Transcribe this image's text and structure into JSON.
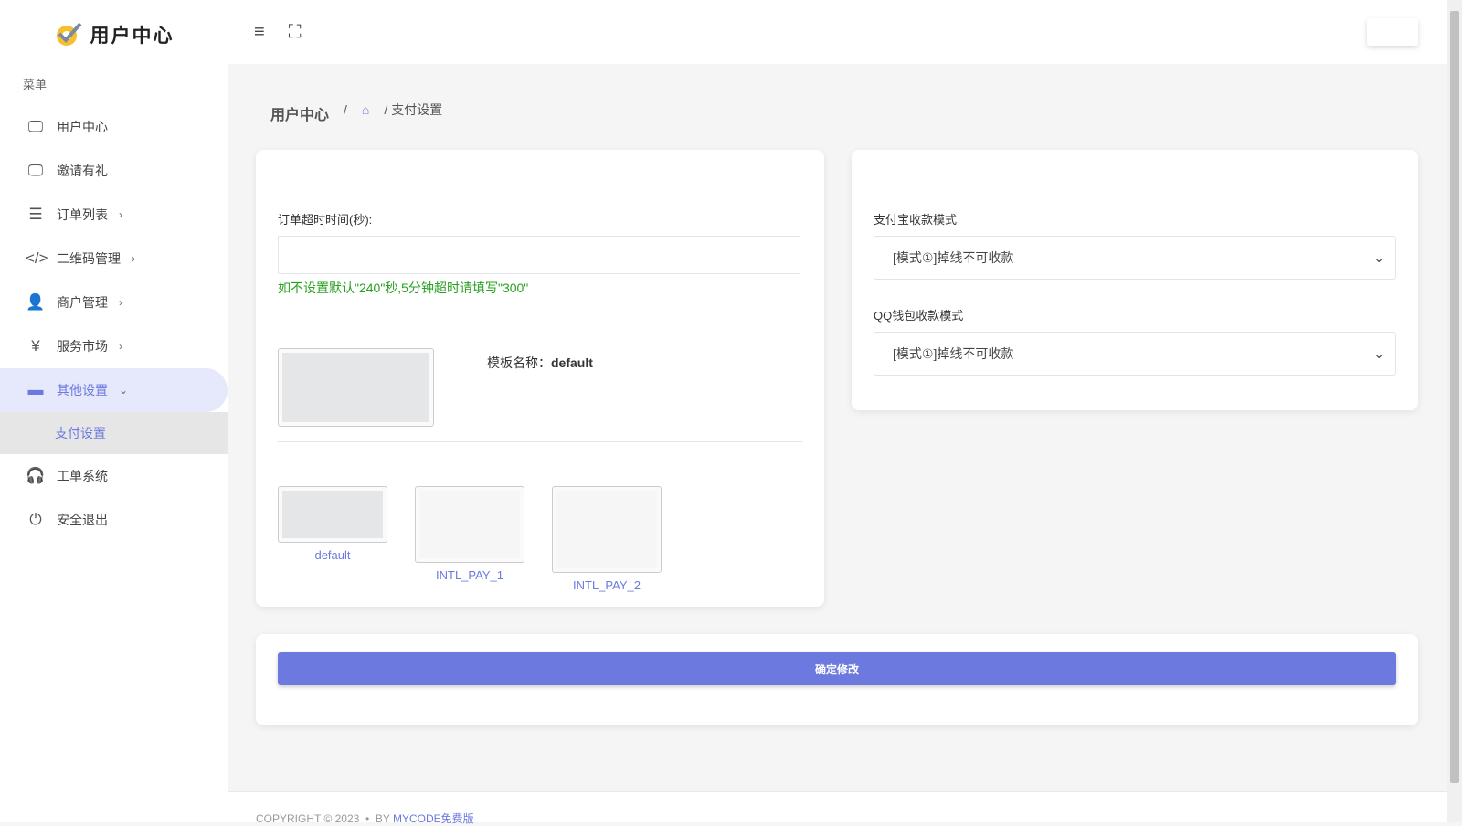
{
  "brand": {
    "title": "用户中心"
  },
  "sidebar": {
    "menu_title": "菜单",
    "items": [
      {
        "label": "用户中心",
        "icon": "monitor-icon"
      },
      {
        "label": "邀请有礼",
        "icon": "monitor-icon"
      },
      {
        "label": "订单列表",
        "icon": "list-icon"
      },
      {
        "label": "二维码管理",
        "icon": "code-icon"
      },
      {
        "label": "商户管理",
        "icon": "user-icon"
      },
      {
        "label": "服务市场",
        "icon": "yen-icon"
      },
      {
        "label": "其他设置",
        "icon": "wallet-icon"
      },
      {
        "label": "工单系统",
        "icon": "headset-icon"
      },
      {
        "label": "安全退出",
        "icon": "power-icon"
      }
    ],
    "sub_item": "支付设置"
  },
  "breadcrumb": {
    "root": "用户中心",
    "current": "支付设置"
  },
  "form": {
    "timeout_label": "订单超时时间(秒):",
    "timeout_value": "",
    "timeout_hint": "如不设置默认\"240\"秒,5分钟超时请填写\"300\"",
    "template_name_label": "模板名称：",
    "template_name": "default",
    "templates": [
      "default",
      "INTL_PAY_1",
      "INTL_PAY_2"
    ],
    "alipay_label": "支付宝收款模式",
    "alipay_value": "[模式①]掉线不可收款",
    "qq_label": "QQ钱包收款模式",
    "qq_value": "[模式①]掉线不可收款",
    "submit": "确定修改"
  },
  "footer": {
    "copyright": "COPYRIGHT © 2023  •  BY ",
    "link": "MYCODE免费版"
  }
}
